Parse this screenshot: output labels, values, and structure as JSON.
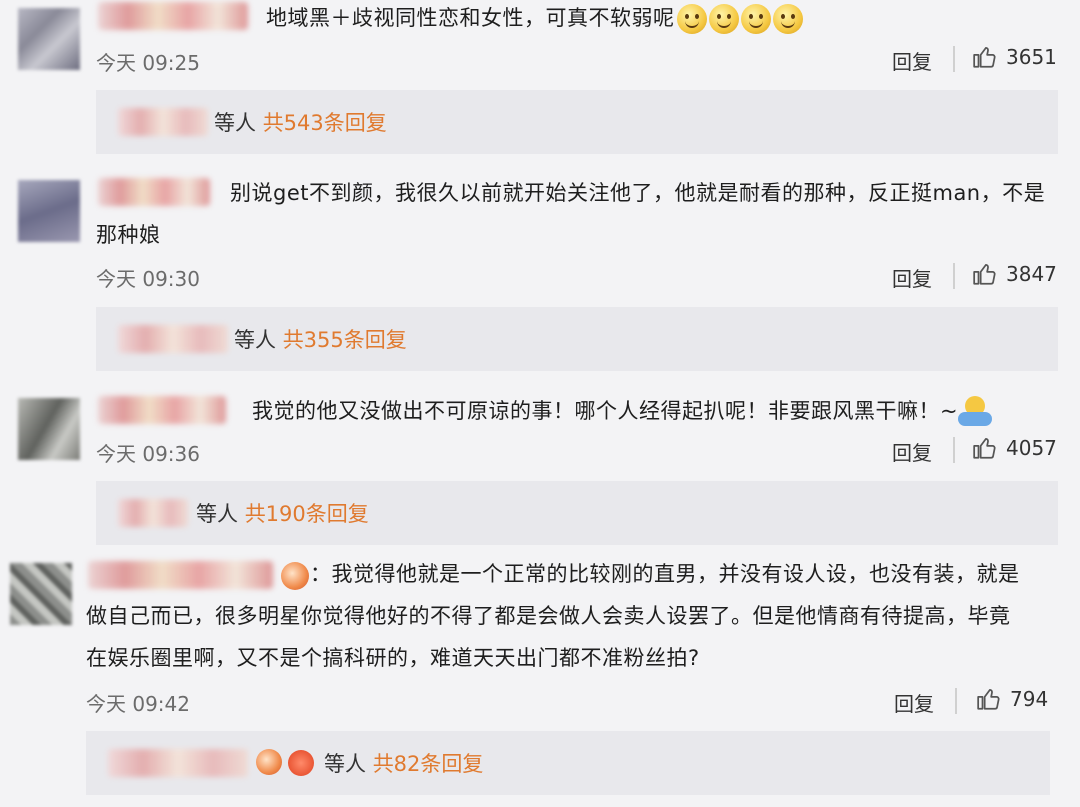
{
  "comments": [
    {
      "text_lines": [
        "地域黑＋歧视同性恋和女性，可真不软弱呢"
      ],
      "emojis": 4,
      "time": "今天 09:25",
      "reply_label": "回复",
      "likes": "3651",
      "sub": {
        "suffix": "等人",
        "count": "共543条回复"
      }
    },
    {
      "text_lines": [
        "别说get不到颜，我很久以前就开始关注他了，他就是耐看的那种，反正挺man，不是",
        "那种娘"
      ],
      "time": "今天 09:30",
      "reply_label": "回复",
      "likes": "3847",
      "sub": {
        "suffix": "等人",
        "count": "共355条回复"
      }
    },
    {
      "text_lines": [
        "我觉的他又没做出不可原谅的事！哪个人经得起扒呢！非要跟风黑干嘛！~"
      ],
      "time": "今天 09:36",
      "reply_label": "回复",
      "likes": "4057",
      "sub": {
        "suffix": "等人",
        "count": "共190条回复"
      }
    },
    {
      "text_lines": [
        "：我觉得他就是一个正常的比较刚的直男，并没有设人设，也没有装，就是",
        "做自己而已，很多明星你觉得他好的不得了都是会做人会卖人设罢了。但是他情商有待提高，毕竟",
        "在娱乐圈里啊，又不是个搞科研的，难道天天出门都不准粉丝拍?"
      ],
      "time": "今天 09:42",
      "reply_label": "回复",
      "likes": "794",
      "sub": {
        "suffix": "等人",
        "count": "共82条回复"
      }
    }
  ],
  "icons": {
    "like": "thumbs-up-icon",
    "smile": "smile-emoji-icon",
    "hug": "hug-emoji-icon"
  },
  "colors": {
    "background": "#f3f3f5",
    "reply_box": "#e8e8ec",
    "accent": "#e07a2f"
  }
}
